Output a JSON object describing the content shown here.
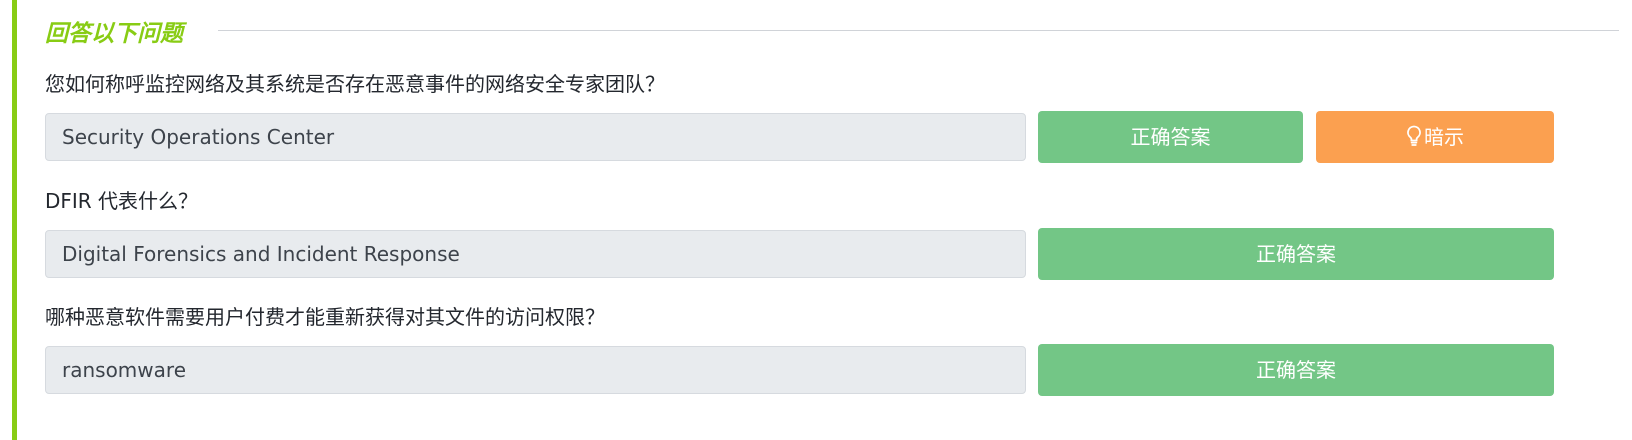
{
  "section": {
    "title": "回答以下问题"
  },
  "questions": [
    {
      "text": "您如何称呼监控网络及其系统是否存在恶意事件的网络安全专家团队？",
      "answer": "Security Operations Center",
      "submit_label": "正确答案",
      "hint_label": "暗示"
    },
    {
      "text": "DFIR 代表什么？",
      "answer": "Digital Forensics and Incident Response",
      "submit_label": "正确答案"
    },
    {
      "text": "哪种恶意软件需要用户付费才能重新获得对其文件的访问权限？",
      "answer": "ransomware",
      "submit_label": "正确答案"
    }
  ],
  "colors": {
    "accent": "#88cc14",
    "correct_button": "#73c686",
    "hint_button": "#fba050",
    "answer_box": "#e8ebee"
  },
  "icons": {
    "hint": "lightbulb-icon"
  }
}
